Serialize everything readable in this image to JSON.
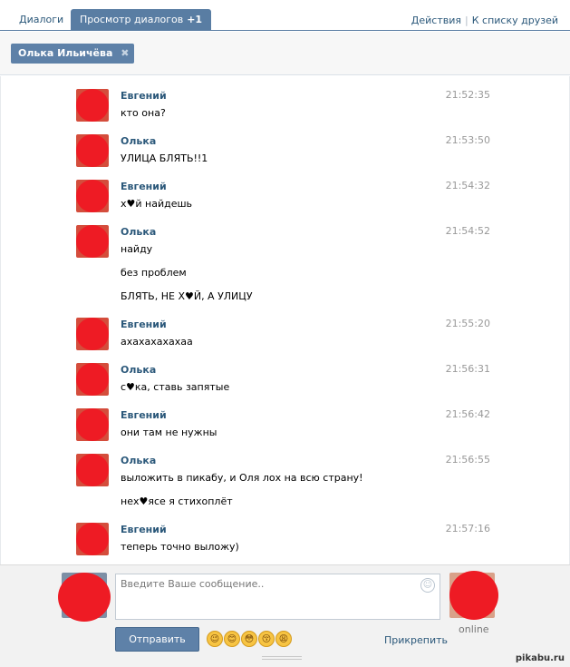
{
  "tabs": {
    "dialogs": "Диалоги",
    "view_dialogs": "Просмотр диалогов",
    "view_count": "+1"
  },
  "top_links": {
    "actions": "Действия",
    "separator": "|",
    "friends": "К списку друзей"
  },
  "recipient": {
    "name": "Олька Ильичёва",
    "remove": "✖"
  },
  "messages": [
    {
      "author": "Евгений",
      "time": "21:52:35",
      "lines": [
        "кто она?"
      ]
    },
    {
      "author": "Олька",
      "time": "21:53:50",
      "lines": [
        "УЛИЦА БЛЯТЬ!!1"
      ]
    },
    {
      "author": "Евгений",
      "time": "21:54:32",
      "lines": [
        "х♥й найдешь"
      ]
    },
    {
      "author": "Олька",
      "time": "21:54:52",
      "lines": [
        "найду",
        "без проблем",
        "БЛЯТЬ, НЕ Х♥Й, А УЛИЦУ"
      ]
    },
    {
      "author": "Евгений",
      "time": "21:55:20",
      "lines": [
        "ахахахахахаа"
      ]
    },
    {
      "author": "Олька",
      "time": "21:56:31",
      "lines": [
        "с♥ка, ставь запятые"
      ]
    },
    {
      "author": "Евгений",
      "time": "21:56:42",
      "lines": [
        "они там не нужны"
      ]
    },
    {
      "author": "Олька",
      "time": "21:56:55",
      "lines": [
        "выложить в пикабу, и Оля лох на всю страну!",
        "нех♥ясе я стихоплёт"
      ]
    },
    {
      "author": "Евгений",
      "time": "21:57:16",
      "lines": [
        "теперь точно выложу)"
      ]
    }
  ],
  "composer": {
    "placeholder": "Введите Ваше сообщение..",
    "send_label": "Отправить",
    "attach_label": "Прикрепить",
    "peer_status": "online",
    "emojis": [
      "😉",
      "😊",
      "😳",
      "😚",
      "😩"
    ]
  },
  "watermark": "pikabu.ru"
}
